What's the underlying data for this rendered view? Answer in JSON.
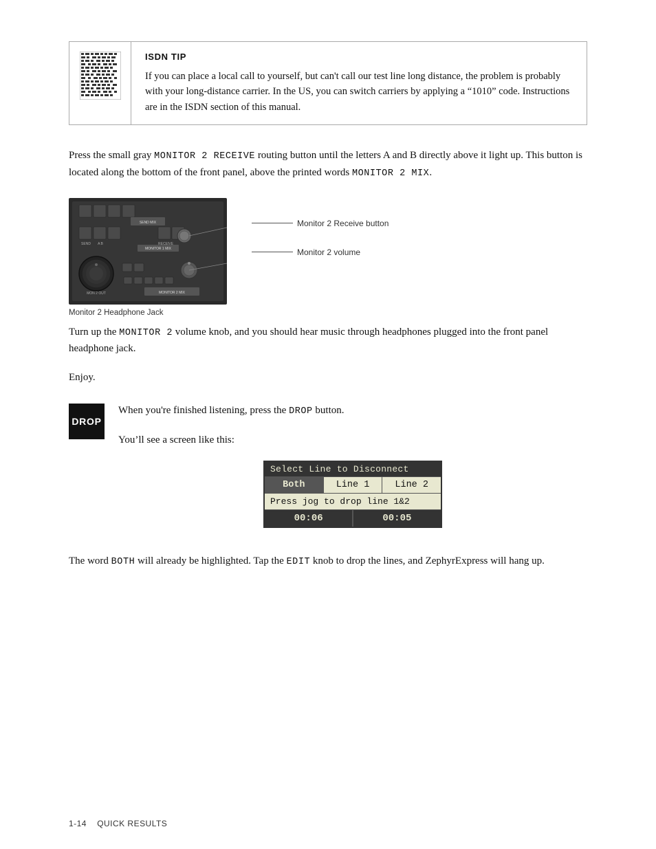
{
  "tip": {
    "title": "ISDN TIP",
    "text": "If you can place a local call to yourself, but can't call our test line long distance, the problem is probably with your long-distance carrier. In the US, you can switch carriers by applying a “1010” code. Instructions are in the ISDN section of this manual."
  },
  "paragraphs": {
    "monitor_button": "Press the small gray MONITOR 2 RECEIVE routing button until the letters A and B directly above it light up. This button is located along the bottom of the front panel, above the printed words MONITOR 2 MIX.",
    "turn_up": "Turn up the MONITOR 2 volume knob, and you should hear music through headphones plugged into the front panel headphone jack.",
    "enjoy": "Enjoy.",
    "drop_para1": "When you’re finished listening, press the DROP button.",
    "drop_para2": "You’ll see a screen like this:",
    "both_para": "The word Both will already be highlighted. Tap the EDIT knob to drop the lines, and ZephyrExpress will hang up."
  },
  "figure": {
    "caption": "Monitor 2 Headphone Jack",
    "label1": "Monitor 2 Receive button",
    "label2": "Monitor 2 volume"
  },
  "screen": {
    "header": "Select Line to Disconnect",
    "cell1": "Both",
    "cell2": "Line 1",
    "cell3": "Line 2",
    "middle_row": "Press jog to drop line 1&2",
    "timer1": "00:06",
    "timer2": "00:05"
  },
  "drop_badge": "DROP",
  "footer": {
    "page": "1-14",
    "section": "QUICK RESULTS"
  }
}
